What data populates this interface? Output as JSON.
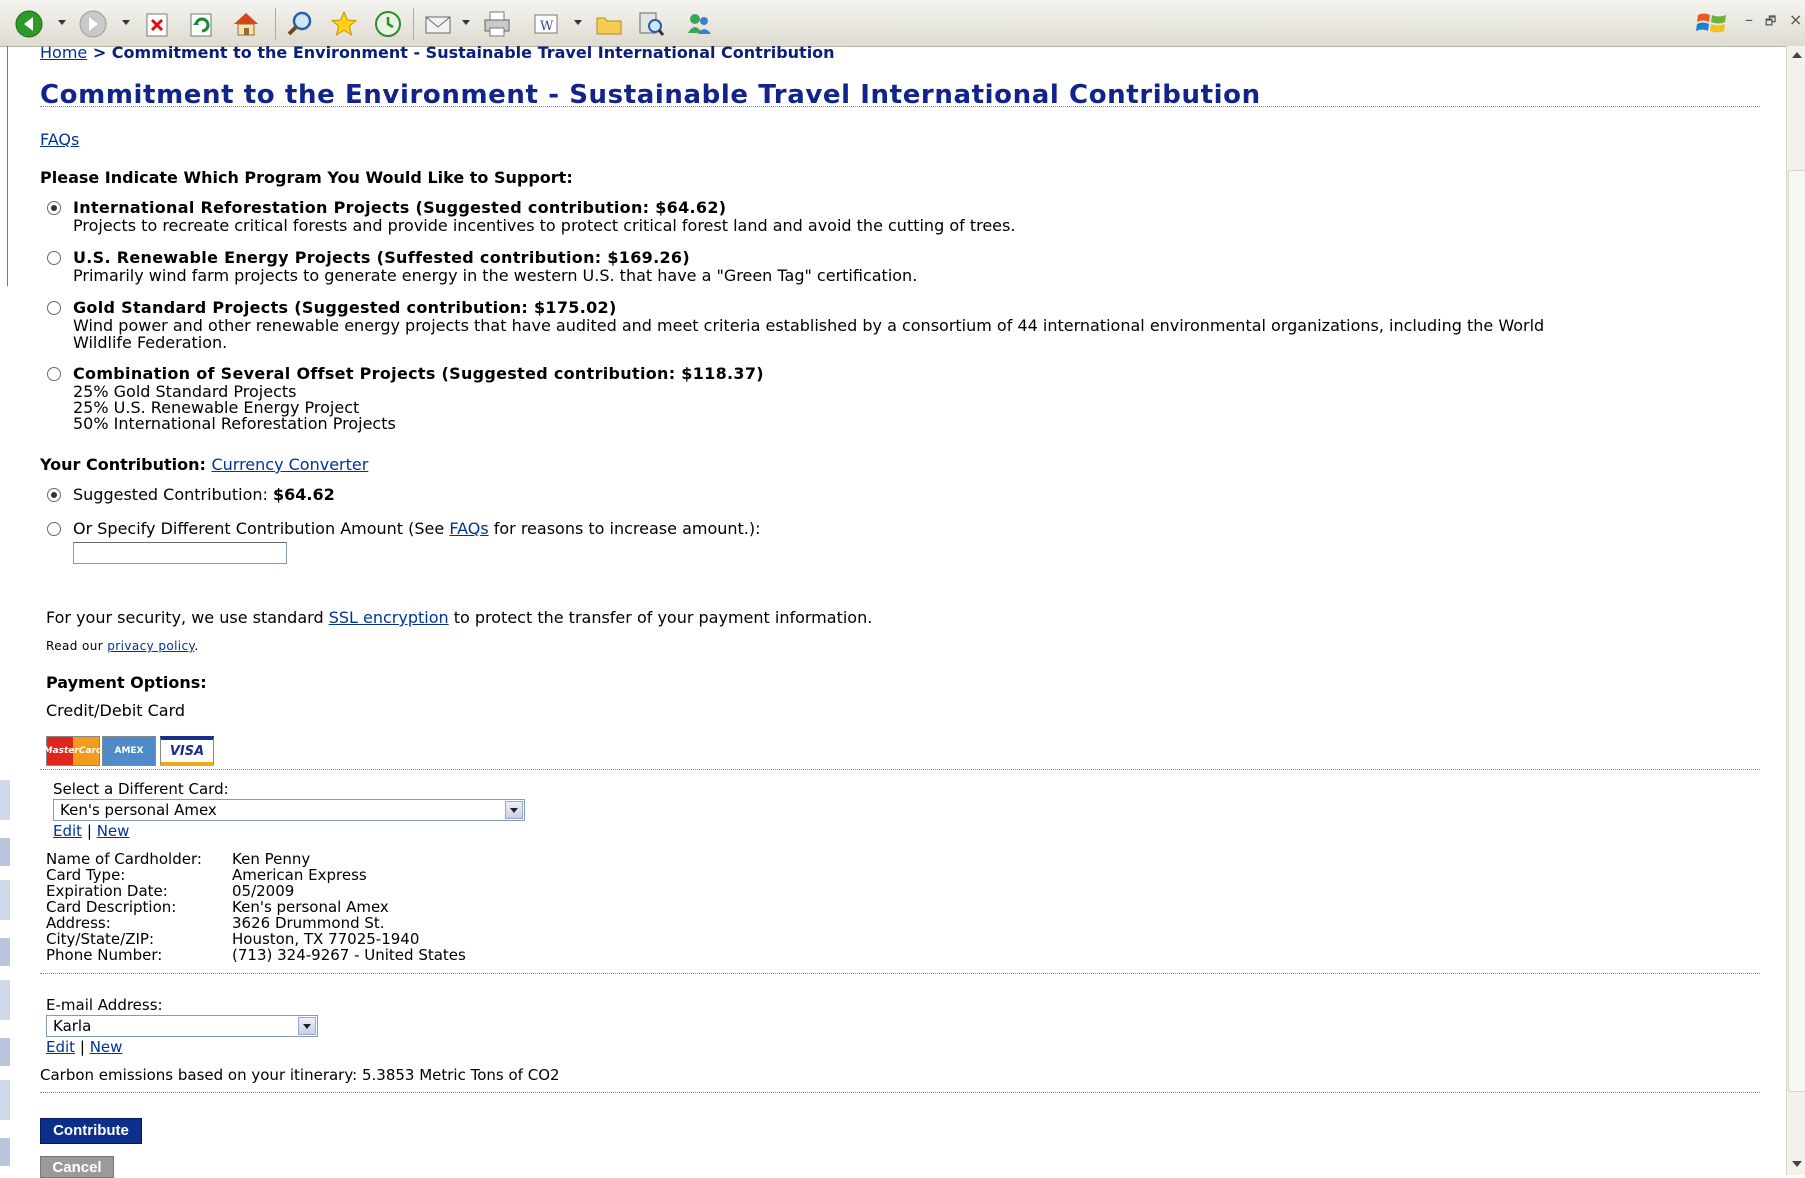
{
  "toolbar": {
    "icons": [
      "back-icon",
      "forward-icon",
      "stop-icon",
      "refresh-icon",
      "home-icon",
      "search-icon",
      "favorites-icon",
      "history-icon",
      "mail-icon",
      "print-icon",
      "edit-icon",
      "folder-icon",
      "research-icon",
      "messenger-icon"
    ],
    "window_minimize": "–",
    "window_restore": "🗗",
    "window_close": "×"
  },
  "breadcrumb": {
    "home": "Home",
    "separator": " > ",
    "current": "Commitment to the Environment - Sustainable Travel International Contribution"
  },
  "page": {
    "title": "Commitment to the Environment - Sustainable Travel International Contribution",
    "faqs_link": "FAQs",
    "program_heading": "Please Indicate Which Program You Would Like to Support:"
  },
  "programs": [
    {
      "title": "International Reforestation Projects (Suggested contribution: $64.62)",
      "desc": [
        "Projects to recreate critical forests and provide incentives to protect critical forest land and avoid the cutting of trees."
      ],
      "selected": true
    },
    {
      "title": "U.S. Renewable Energy Projects (Suffested contribution: $169.26)",
      "desc": [
        "Primarily wind farm projects to generate energy in the western U.S. that have a \"Green Tag\" certification."
      ],
      "selected": false
    },
    {
      "title": "Gold Standard Projects (Suggested contribution: $175.02)",
      "desc": [
        "Wind power and other renewable energy projects that have audited and meet criteria established by a consortium of 44 international environmental organizations, including the World",
        "Wildlife Federation."
      ],
      "selected": false
    },
    {
      "title": "Combination of Several Offset Projects (Suggested contribution: $118.37)",
      "desc": [
        "25% Gold Standard Projects",
        "25% U.S. Renewable Energy Project",
        "50% International Reforestation Projects"
      ],
      "selected": false
    }
  ],
  "contribution": {
    "heading": "Your Contribution:",
    "currency_link": "Currency Converter",
    "suggested_label": "Suggested Contribution: ",
    "suggested_amount": "$64.62",
    "suggested_selected": true,
    "specify_prefix": "Or Specify Different Contribution Amount (See ",
    "specify_link": "FAQs",
    "specify_suffix": " for reasons to increase amount.):",
    "specify_value": ""
  },
  "security": {
    "prefix": "For your security, we use standard ",
    "ssl_link": "SSL encryption",
    "suffix": " to protect the transfer of your payment information.",
    "privacy_prefix": "Read our ",
    "privacy_link": "privacy policy",
    "privacy_suffix": "."
  },
  "payment": {
    "heading": "Payment Options:",
    "method": "Credit/Debit Card",
    "card_logos": [
      "MasterCard",
      "AMEX",
      "VISA"
    ],
    "select_label": "Select a Different Card:",
    "selected_card": "Ken's personal Amex",
    "edit_link": "Edit",
    "divider": "|",
    "new_link": "New",
    "details": [
      {
        "label": "Name of Cardholder:",
        "value": "Ken Penny"
      },
      {
        "label": "Card Type:",
        "value": "American Express"
      },
      {
        "label": "Expiration Date:",
        "value": "05/2009"
      },
      {
        "label": "Card Description:",
        "value": "Ken's personal Amex"
      },
      {
        "label": "Address:",
        "value": "3626 Drummond St."
      },
      {
        "label": "City/State/ZIP:",
        "value": "Houston, TX 77025-1940"
      },
      {
        "label": "Phone Number:",
        "value": "(713) 324-9267 - United States"
      }
    ]
  },
  "email": {
    "label": "E-mail Address:",
    "selected": "Karla",
    "edit_link": "Edit",
    "divider": "|",
    "new_link": "New"
  },
  "carbon_text": "Carbon emissions based on your itinerary: 5.3853 Metric Tons of CO2",
  "buttons": {
    "contribute": "Contribute",
    "cancel": "Cancel"
  },
  "colors": {
    "title": "#12238a",
    "link": "#003399",
    "contribute_button": "#0d2f8c"
  }
}
